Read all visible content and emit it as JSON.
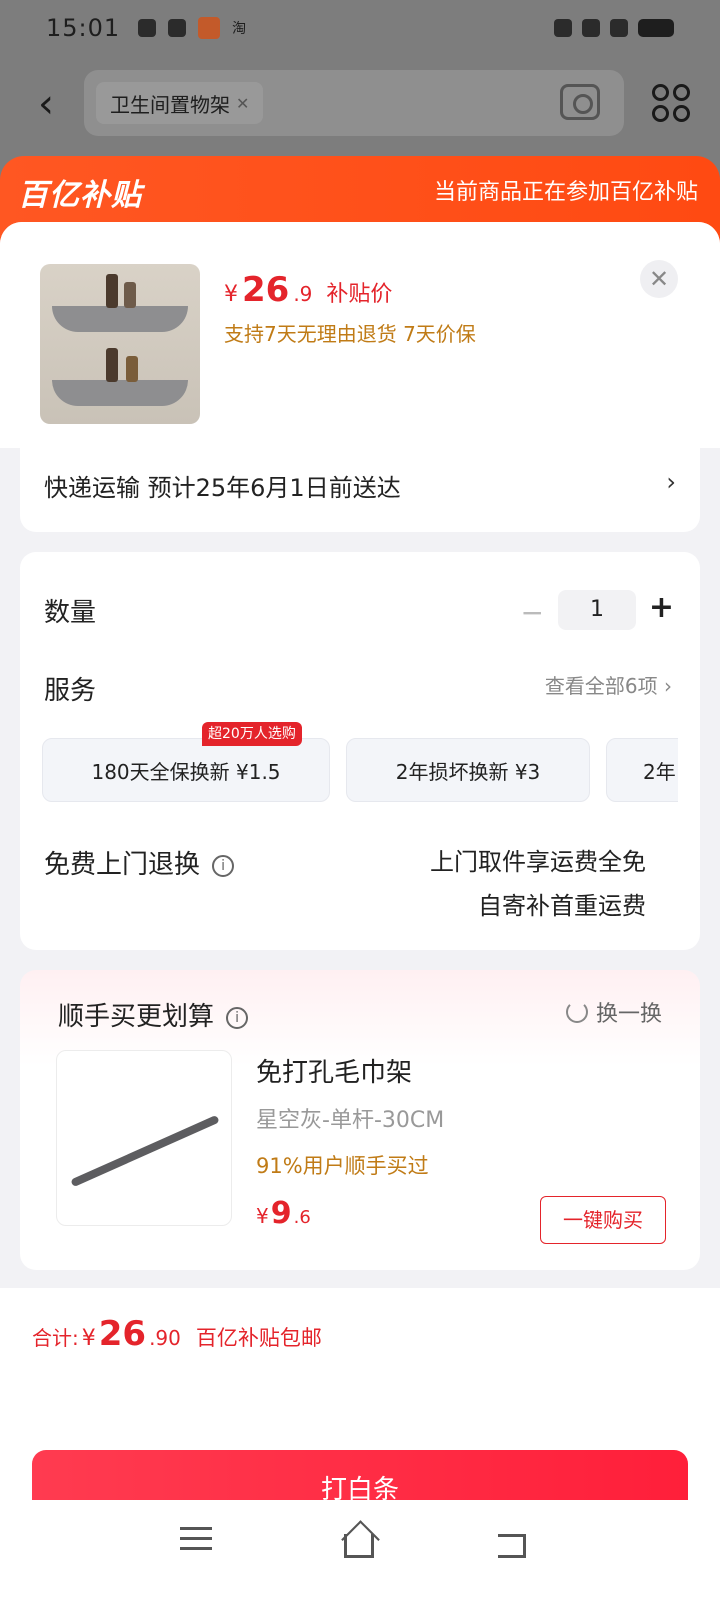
{
  "status_bar": {
    "time": "15:01",
    "carrier_icon": "淘"
  },
  "search": {
    "chip_text": "卫生间置物架"
  },
  "banner": {
    "logo": "百亿补贴",
    "text": "当前商品正在参加百亿补贴"
  },
  "product": {
    "price_currency": "¥",
    "price_integer": "26",
    "price_decimal": ".9",
    "price_tag": "补贴价",
    "guarantee": "支持7天无理由退货  7天价保"
  },
  "shipping": {
    "text": "快递运输 预计25年6月1日前送达"
  },
  "quantity": {
    "label": "数量",
    "minus": "−",
    "value": "1",
    "plus": "+"
  },
  "services": {
    "label": "服务",
    "view_all": "查看全部6项",
    "hot_badge": "超20万人选购",
    "items": [
      {
        "label": "180天全保换新  ¥1.5"
      },
      {
        "label": "2年损坏换新  ¥3"
      },
      {
        "label": "2年"
      }
    ]
  },
  "returns": {
    "label": "免费上门退换",
    "info_icon": "i",
    "line1": "上门取件享运费全免",
    "line2": "自寄补首重运费"
  },
  "upsell": {
    "title": "顺手买更划算",
    "refresh": "换一换",
    "item": {
      "name": "免打孔毛巾架",
      "spec": "星空灰-单杆-30CM",
      "percent_text": "91%用户顺手买过",
      "price_currency": "¥",
      "price_integer": "9",
      "price_decimal": ".6",
      "buy_label": "一键购买"
    }
  },
  "footer": {
    "total_label": "合计:",
    "total_currency": "¥",
    "total_integer": "26",
    "total_decimal": ".90",
    "total_note": "百亿补贴包邮",
    "pay_label": "打白条"
  },
  "colors": {
    "accent_red": "#e4242b",
    "banner_orange": "#ff5722",
    "gold": "#c07b16"
  }
}
